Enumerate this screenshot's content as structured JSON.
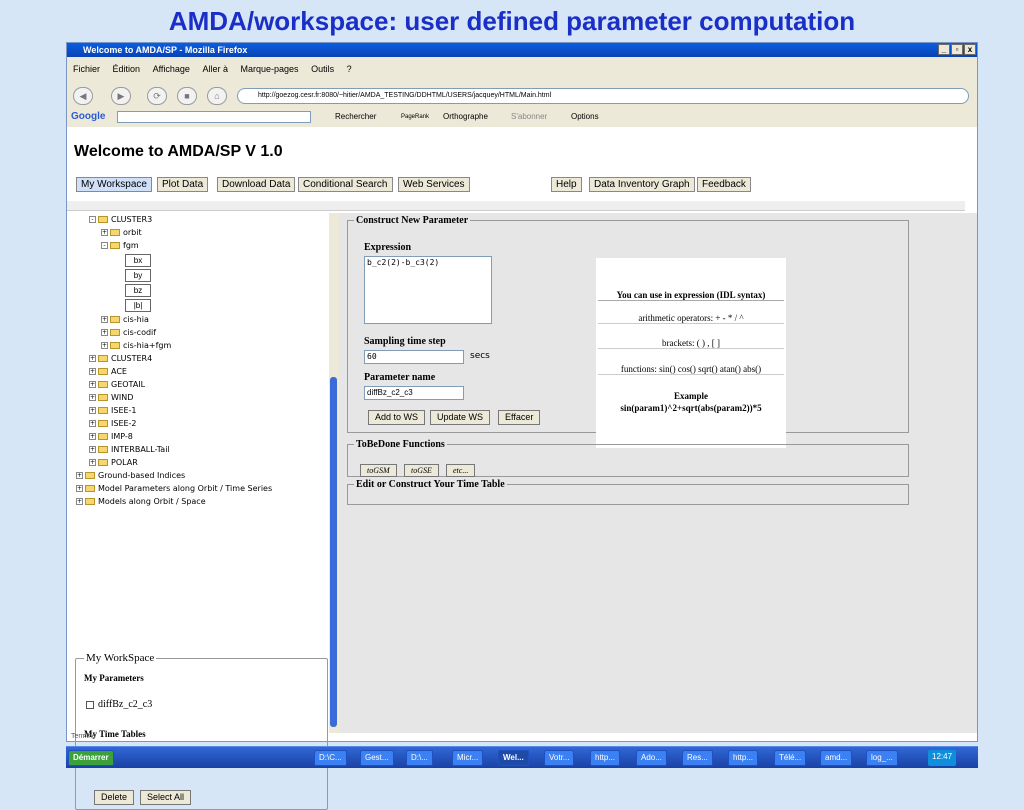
{
  "slide_title": "AMDA/workspace: user defined parameter computation",
  "window": {
    "title": "Welcome to AMDA/SP - Mozilla Firefox",
    "btn_min": "_",
    "btn_max": "̅",
    "btn_close": "x"
  },
  "menu": [
    "Fichier",
    "Édition",
    "Affichage",
    "Aller à",
    "Marque-pages",
    "Outils",
    "?"
  ],
  "url": "http://goezog.cesr.fr:8080/~hitier/AMDA_TESTING/DDHTML/USERS/jacquey/HTML/Main.html",
  "google": {
    "label": "Google",
    "search": "Rechercher",
    "pagerank": "PageRank",
    "ortho": "Orthographe",
    "subscribe": "S'abonner",
    "options": "Options"
  },
  "page": {
    "welcome": "Welcome to AMDA/SP V 1.0",
    "tabs": [
      "My Workspace",
      "Plot Data",
      "Download Data",
      "Conditional Search",
      "Web Services"
    ],
    "tabs_right": [
      "Help",
      "Data Inventory Graph",
      "Feedback"
    ]
  },
  "tree": {
    "cluster3": "CLUSTER3",
    "orbit": "orbit",
    "fgm": "fgm",
    "leaves": [
      "bx",
      "by",
      "bz",
      "|b|"
    ],
    "others": [
      "cis-hia",
      "cis-codif",
      "cis-hia+fgm"
    ],
    "missions": [
      "CLUSTER4",
      "ACE",
      "GEOTAIL",
      "WIND",
      "ISEE-1",
      "ISEE-2",
      "IMP-8",
      "INTERBALL-Tail",
      "POLAR"
    ],
    "groups": [
      "Ground-based Indices",
      "Model Parameters along Orbit / Time Series",
      "Models along Orbit / Space"
    ]
  },
  "workspace": {
    "legend": "My WorkSpace",
    "params_title": "My Parameters",
    "param": "diffBz_c2_c3",
    "tables_title": "My Time Tables",
    "delete": "Delete",
    "select_all": "Select All"
  },
  "construct": {
    "legend": "Construct New Parameter",
    "expr_label": "Expression",
    "expr_value": "b_c2(2)-b_c3(2)",
    "step_label": "Sampling time step",
    "step_value": "60",
    "step_unit": "secs",
    "name_label": "Parameter name",
    "name_value": "diffBz_c2_c3",
    "add": "Add to WS",
    "update": "Update WS",
    "clear": "Effacer"
  },
  "help": {
    "title": "You can use in expression (IDL syntax)",
    "arith": "arithmetic operators: + - * / ^",
    "brackets": "brackets: ( ) , [ ]",
    "functions": "functions: sin() cos() sqrt() atan() abs()",
    "example_title": "Example",
    "example": "sin(param1)^2+sqrt(abs(param2))*5"
  },
  "tobedone": {
    "legend": "ToBeDone Functions",
    "btns": [
      "toGSM",
      "toGSE",
      "etc..."
    ]
  },
  "timetable": {
    "legend": "Edit or Construct Your Time Table"
  },
  "status": "Terminé",
  "taskbar": {
    "start": "Démarrer",
    "items": [
      "D:\\C...",
      "Gest...",
      "D:\\...",
      "Micr...",
      "Wel...",
      "Votr...",
      "http...",
      "Ado...",
      "Res...",
      "http...",
      "Télé...",
      "amd...",
      "log_..."
    ],
    "clock": "12:47"
  }
}
